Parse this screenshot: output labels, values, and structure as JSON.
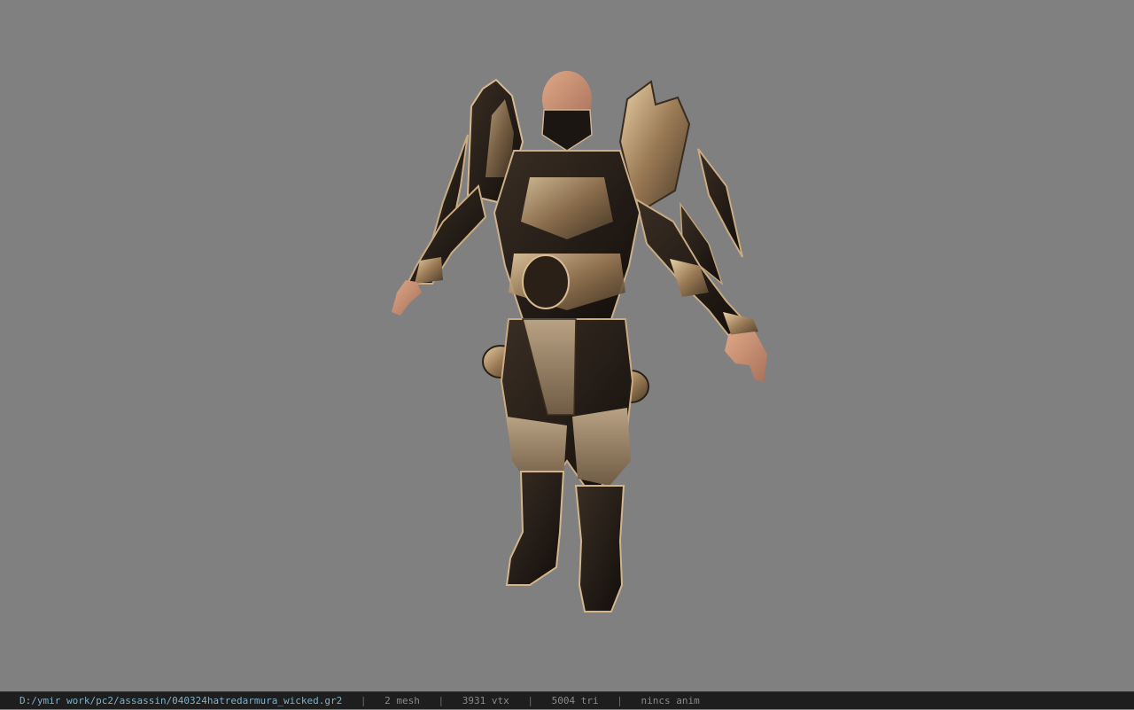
{
  "viewer": {
    "background_color": "#808080",
    "model_label": "assassin armor character model"
  },
  "status_bar": {
    "file_path": "D:/ymir work/pc2/assassin/040324hatredarmura_wicked.gr2",
    "separator": "|",
    "mesh": "2 mesh",
    "vertices": "3931 vtx",
    "triangles": "5004 tri",
    "anim": "nincs anim",
    "path_color": "#7fb0c8",
    "text_color": "#8a8a8a"
  }
}
